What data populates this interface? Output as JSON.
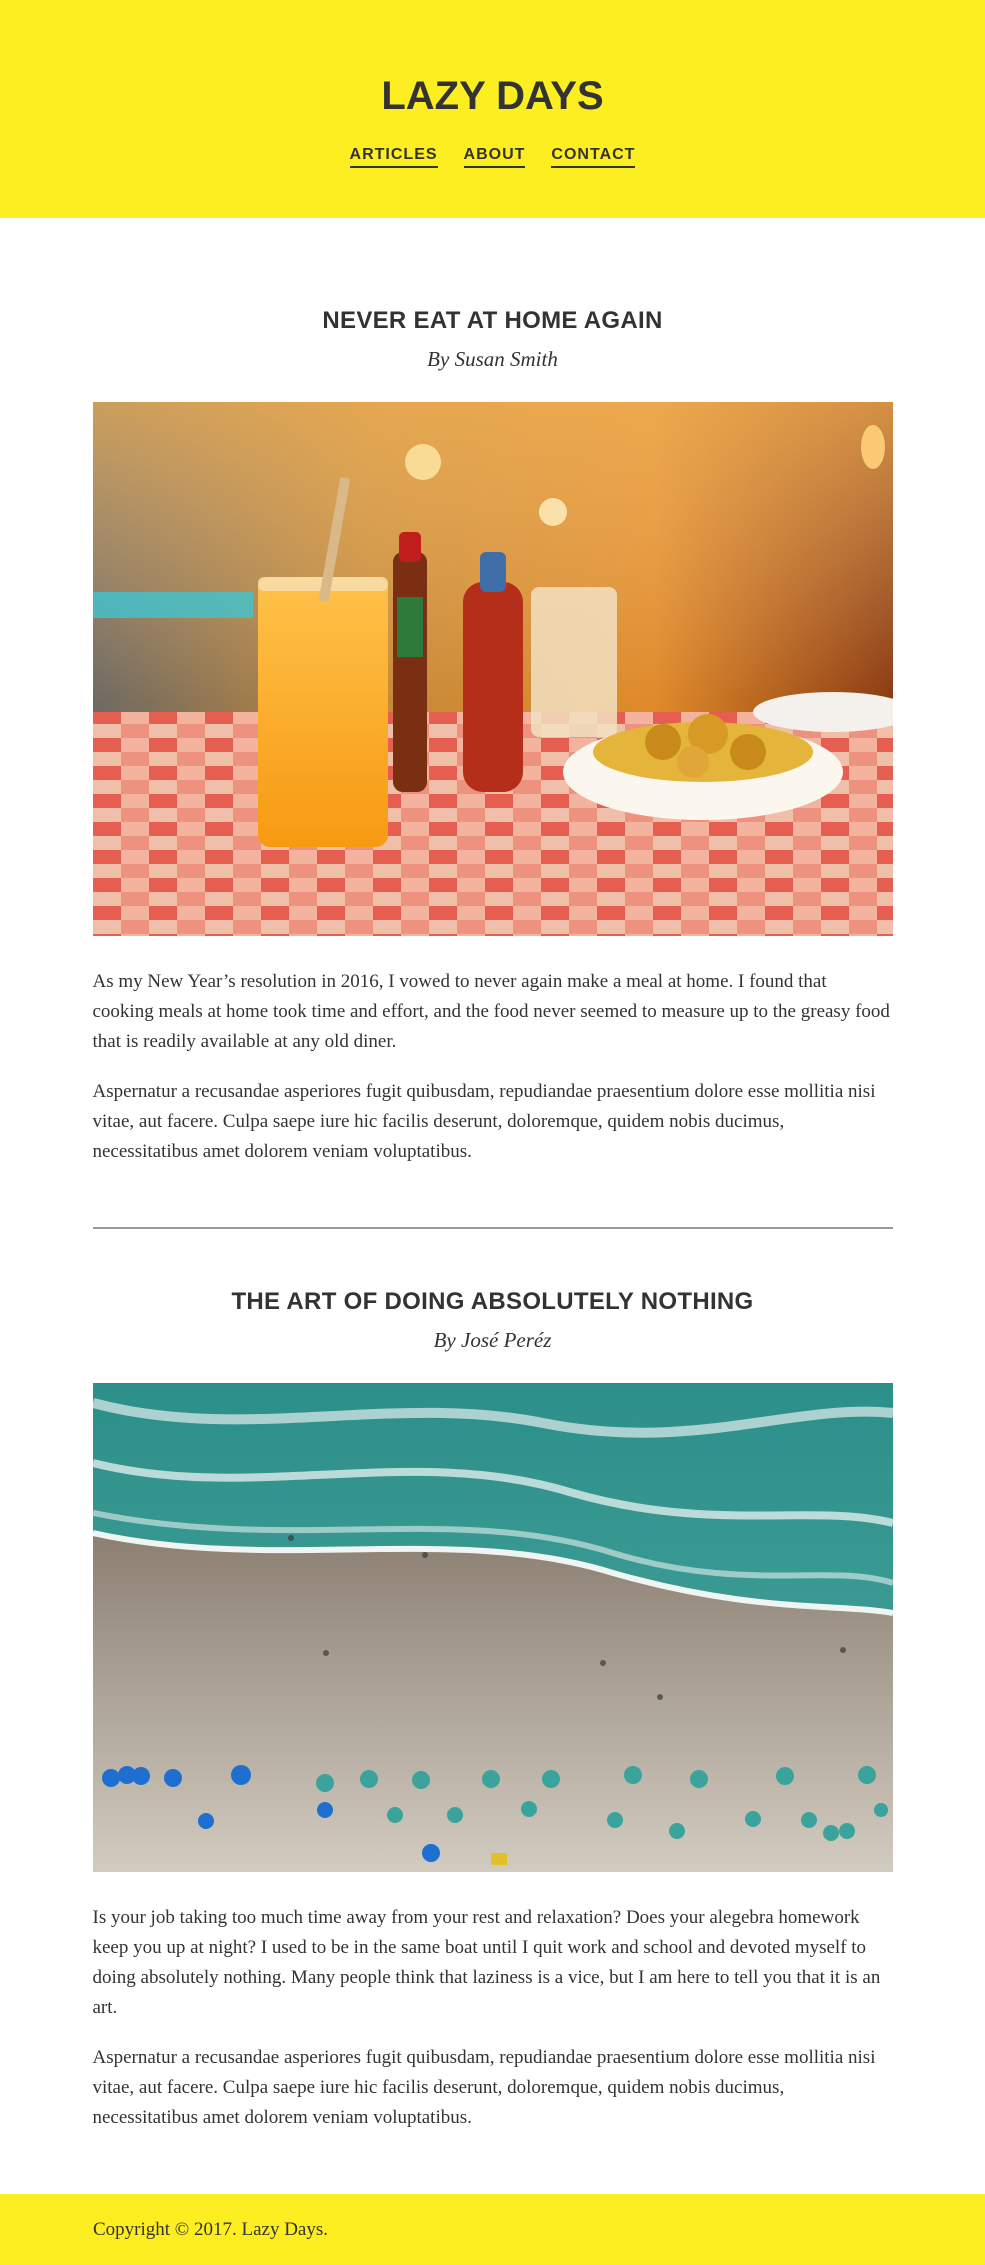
{
  "header": {
    "title": "LAZY DAYS",
    "nav": [
      {
        "label": "ARTICLES"
      },
      {
        "label": "ABOUT"
      },
      {
        "label": "CONTACT"
      }
    ]
  },
  "articles": [
    {
      "title": "NEVER EAT AT HOME AGAIN",
      "byline": "By Susan Smith",
      "image": "diner-table-orange-juice-photo",
      "paragraphs": [
        "As my New Year’s resolution in 2016, I vowed to never again make a meal at home. I found that cooking meals at home took time and effort, and the food never seemed to measure up to the greasy food that is readily available at any old diner.",
        "Aspernatur a recusandae asperiores fugit quibusdam, repudiandae praesentium dolore esse mollitia nisi vitae, aut facere. Culpa saepe iure hic facilis deserunt, doloremque, quidem nobis ducimus, necessitatibus amet dolorem veniam voluptatibus."
      ]
    },
    {
      "title": "THE ART OF DOING ABSOLUTELY NOTHING",
      "byline": "By José Peréz",
      "image": "aerial-beach-umbrellas-photo",
      "paragraphs": [
        "Is your job taking too much time away from your rest and relaxation? Does your alegebra homework keep you up at night? I used to be in the same boat until I quit work and school and devoted myself to doing absolutely nothing. Many people think that laziness is a vice, but I am here to tell you that it is an art.",
        "Aspernatur a recusandae asperiores fugit quibusdam, repudiandae praesentium dolore esse mollitia nisi vitae, aut facere. Culpa saepe iure hic facilis deserunt, doloremque, quidem nobis ducimus, necessitatibus amet dolorem veniam voluptatibus."
      ]
    }
  ],
  "footer": {
    "copyright": "Copyright © 2017. Lazy Days."
  },
  "colors": {
    "accent": "#fdee21",
    "text": "#333333",
    "divider": "#9a9a9a"
  }
}
